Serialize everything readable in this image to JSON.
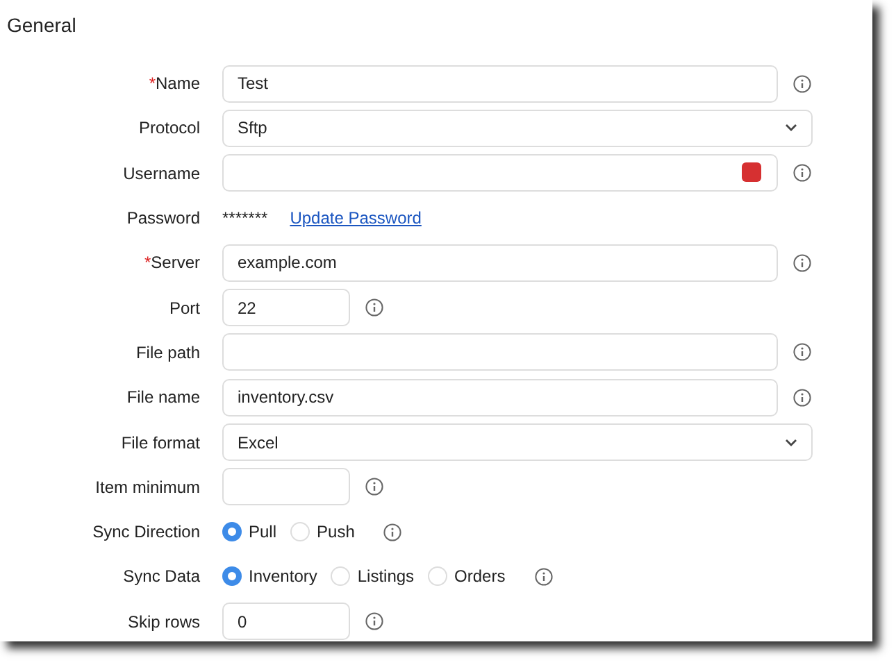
{
  "section": {
    "title": "General"
  },
  "fields": [
    {
      "kind": "text",
      "label": "Name",
      "required_mark": "*",
      "value": "Test",
      "info": true
    },
    {
      "kind": "select",
      "label": "Protocol",
      "value": "Sftp"
    },
    {
      "kind": "text",
      "label": "Username",
      "info": true,
      "password_manager": true
    },
    {
      "kind": "password",
      "label": "Password",
      "value": "*******",
      "link": "Update Password"
    },
    {
      "kind": "text",
      "label": "Server",
      "required_mark": "*",
      "value": "example.com",
      "info": true
    },
    {
      "kind": "short_text",
      "label": "Port",
      "value": "22",
      "info": true
    },
    {
      "kind": "text",
      "label": "File path",
      "info": true
    },
    {
      "kind": "text",
      "label": "File name",
      "value": "inventory.csv",
      "info": true
    },
    {
      "kind": "select",
      "label": "File format",
      "value": "Excel"
    },
    {
      "kind": "short_text",
      "label": "Item minimum",
      "info": true
    },
    {
      "kind": "radio",
      "label": "Sync Direction",
      "info": true,
      "options": [
        {
          "label": "Pull",
          "selected": true
        },
        {
          "label": "Push",
          "selected": false
        }
      ]
    },
    {
      "kind": "radio",
      "label": "Sync Data",
      "info": true,
      "options": [
        {
          "label": "Inventory",
          "selected": true
        },
        {
          "label": "Listings",
          "selected": false
        },
        {
          "label": "Orders",
          "selected": false
        }
      ]
    },
    {
      "kind": "short_text",
      "label": "Skip rows",
      "value": "0",
      "info": true
    }
  ]
}
